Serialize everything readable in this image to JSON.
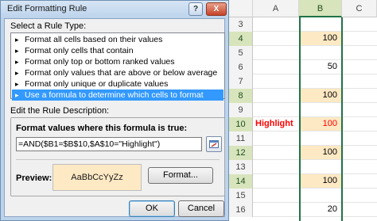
{
  "dialog": {
    "title": "Edit Formatting Rule",
    "help_label": "?",
    "close_label": "X",
    "select_rule_type_label": "Select a Rule Type:",
    "rule_types": [
      "Format all cells based on their values",
      "Format only cells that contain",
      "Format only top or bottom ranked values",
      "Format only values that are above or below average",
      "Format only unique or duplicate values",
      "Use a formula to determine which cells to format"
    ],
    "selected_rule_index": 5,
    "edit_description_label": "Edit the Rule Description:",
    "formula_label": "Format values where this formula is true:",
    "formula_value": "=AND($B1=$B$10,$A$10=\"Highlight\")",
    "preview_label": "Preview:",
    "preview_sample": "AaBbCcYyZz",
    "format_button": "Format...",
    "ok_button": "OK",
    "cancel_button": "Cancel",
    "preview_fill": "#fde9c4",
    "selection_color": "#3399ff"
  },
  "sheet": {
    "columns": [
      "A",
      "B",
      "C"
    ],
    "selected_column": "B",
    "rows": [
      {
        "num": "3",
        "a": "",
        "b": "",
        "hl": false
      },
      {
        "num": "4",
        "a": "",
        "b": "100",
        "hl": true
      },
      {
        "num": "5",
        "a": "",
        "b": "",
        "hl": false
      },
      {
        "num": "6",
        "a": "",
        "b": "50",
        "hl": false
      },
      {
        "num": "7",
        "a": "",
        "b": "",
        "hl": false
      },
      {
        "num": "8",
        "a": "",
        "b": "100",
        "hl": true
      },
      {
        "num": "9",
        "a": "",
        "b": "",
        "hl": false
      },
      {
        "num": "10",
        "a": "Highlight",
        "b": "100",
        "hl": true
      },
      {
        "num": "11",
        "a": "",
        "b": "",
        "hl": false
      },
      {
        "num": "12",
        "a": "",
        "b": "100",
        "hl": true
      },
      {
        "num": "13",
        "a": "",
        "b": "",
        "hl": false
      },
      {
        "num": "14",
        "a": "",
        "b": "100",
        "hl": true
      },
      {
        "num": "15",
        "a": "",
        "b": "",
        "hl": false
      },
      {
        "num": "16",
        "a": "",
        "b": "20",
        "hl": false
      }
    ],
    "highlight_fill": "#fde9c4",
    "accent_text_color": "#ff0000"
  }
}
